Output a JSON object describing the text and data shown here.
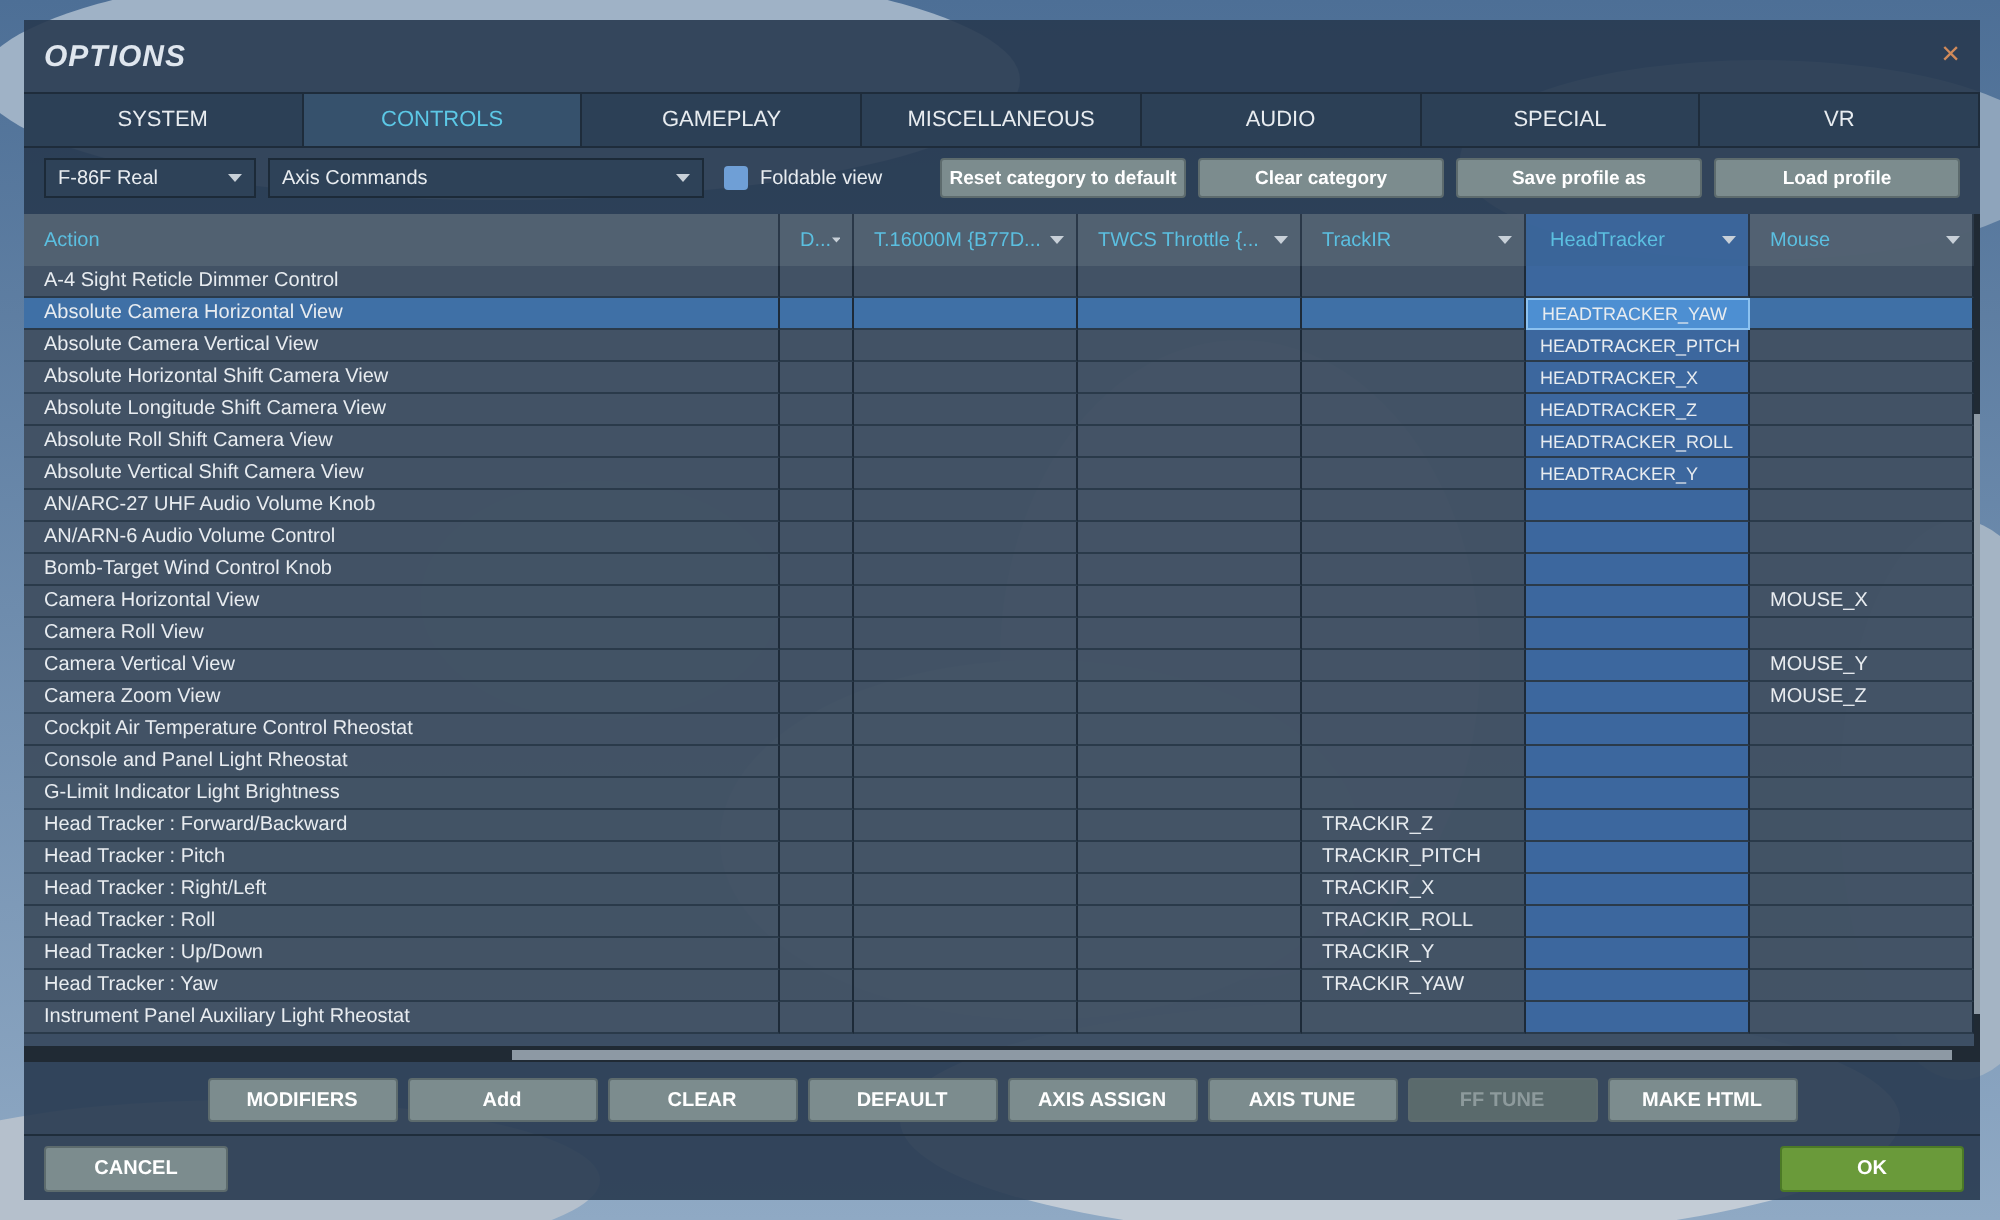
{
  "window": {
    "title": "OPTIONS",
    "close": "×"
  },
  "tabs": [
    {
      "label": "SYSTEM",
      "selected": false
    },
    {
      "label": "CONTROLS",
      "selected": true
    },
    {
      "label": "GAMEPLAY",
      "selected": false
    },
    {
      "label": "MISCELLANEOUS",
      "selected": false
    },
    {
      "label": "AUDIO",
      "selected": false
    },
    {
      "label": "SPECIAL",
      "selected": false
    },
    {
      "label": "VR",
      "selected": false
    }
  ],
  "toolbar": {
    "aircraft": "F-86F Real",
    "category": "Axis Commands",
    "foldable_view": {
      "label": "Foldable view",
      "checked": false
    },
    "buttons": [
      "Reset category to default",
      "Clear category",
      "Save profile as",
      "Load profile"
    ]
  },
  "table": {
    "columns": [
      {
        "label": "Action",
        "selected": false
      },
      {
        "label": "D...",
        "selected": false
      },
      {
        "label": "T.16000M {B77D...",
        "selected": false
      },
      {
        "label": "TWCS Throttle {...",
        "selected": false
      },
      {
        "label": "TrackIR",
        "selected": false
      },
      {
        "label": "HeadTracker",
        "selected": true
      },
      {
        "label": "Mouse",
        "selected": false
      }
    ],
    "rows": [
      {
        "action": "A-4 Sight Reticle Dimmer Control",
        "selected": false
      },
      {
        "action": "Absolute Camera Horizontal View",
        "selected": true,
        "headtracker": "HEADTRACKER_YAW"
      },
      {
        "action": "Absolute Camera Vertical View",
        "selected": false,
        "headtracker": "HEADTRACKER_PITCH"
      },
      {
        "action": "Absolute Horizontal Shift Camera View",
        "selected": false,
        "headtracker": "HEADTRACKER_X"
      },
      {
        "action": "Absolute Longitude Shift Camera View",
        "selected": false,
        "headtracker": "HEADTRACKER_Z"
      },
      {
        "action": "Absolute Roll Shift Camera View",
        "selected": false,
        "headtracker": "HEADTRACKER_ROLL"
      },
      {
        "action": "Absolute Vertical Shift Camera View",
        "selected": false,
        "headtracker": "HEADTRACKER_Y"
      },
      {
        "action": "AN/ARC-27 UHF Audio Volume Knob",
        "selected": false
      },
      {
        "action": "AN/ARN-6 Audio Volume Control",
        "selected": false
      },
      {
        "action": "Bomb-Target Wind Control Knob",
        "selected": false
      },
      {
        "action": "Camera Horizontal View",
        "selected": false,
        "mouse": "MOUSE_X"
      },
      {
        "action": "Camera Roll View",
        "selected": false
      },
      {
        "action": "Camera Vertical View",
        "selected": false,
        "mouse": "MOUSE_Y"
      },
      {
        "action": "Camera Zoom View",
        "selected": false,
        "mouse": "MOUSE_Z"
      },
      {
        "action": "Cockpit Air Temperature Control Rheostat",
        "selected": false
      },
      {
        "action": "Console and Panel Light Rheostat",
        "selected": false
      },
      {
        "action": "G-Limit Indicator Light Brightness",
        "selected": false
      },
      {
        "action": "Head Tracker : Forward/Backward",
        "selected": false,
        "trackir": "TRACKIR_Z"
      },
      {
        "action": "Head Tracker : Pitch",
        "selected": false,
        "trackir": "TRACKIR_PITCH"
      },
      {
        "action": "Head Tracker : Right/Left",
        "selected": false,
        "trackir": "TRACKIR_X"
      },
      {
        "action": "Head Tracker : Roll",
        "selected": false,
        "trackir": "TRACKIR_ROLL"
      },
      {
        "action": "Head Tracker : Up/Down",
        "selected": false,
        "trackir": "TRACKIR_Y"
      },
      {
        "action": "Head Tracker : Yaw",
        "selected": false,
        "trackir": "TRACKIR_YAW"
      },
      {
        "action": "Instrument Panel Auxiliary Light Rheostat",
        "selected": false
      }
    ]
  },
  "actions": [
    {
      "label": "MODIFIERS",
      "disabled": false
    },
    {
      "label": "Add",
      "disabled": false
    },
    {
      "label": "CLEAR",
      "disabled": false
    },
    {
      "label": "DEFAULT",
      "disabled": false
    },
    {
      "label": "AXIS ASSIGN",
      "disabled": false
    },
    {
      "label": "AXIS TUNE",
      "disabled": false
    },
    {
      "label": "FF TUNE",
      "disabled": true
    },
    {
      "label": "MAKE HTML",
      "disabled": false
    }
  ],
  "footer": [
    {
      "label": "CANCEL",
      "kind": "cancel"
    },
    {
      "label": "OK",
      "kind": "confirm"
    }
  ]
}
